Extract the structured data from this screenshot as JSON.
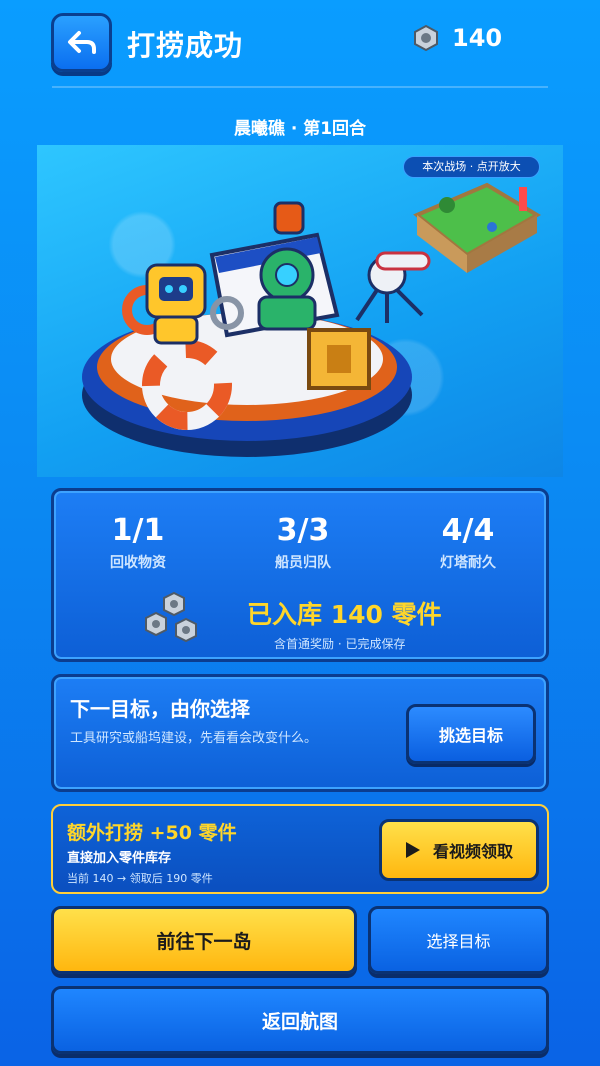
{
  "header": {
    "title": "打捞成功",
    "coins": "140"
  },
  "subtitle": "晨曦礁 · 第1回合",
  "scene": {
    "minimap_label": "本次战场 · 点开放大"
  },
  "stats": {
    "items": [
      {
        "value": "1/1",
        "label": "回收物资"
      },
      {
        "value": "3/3",
        "label": "船员归队"
      },
      {
        "value": "4/4",
        "label": "灯塔耐久"
      }
    ],
    "stored": "已入库 140 零件",
    "note": "含首通奖励 · 已完成保存"
  },
  "next_goal": {
    "title": "下一目标，由你选择",
    "desc": "工具研究或船坞建设，先看看会改变什么。",
    "button": "挑选目标"
  },
  "bonus": {
    "title": "额外打捞 +50 零件",
    "sub": "直接加入零件库存",
    "note": "当前 140 → 领取后 190 零件",
    "button": "看视频领取"
  },
  "actions": {
    "next_island": "前往下一岛",
    "select_target": "选择目标",
    "back_map": "返回航图"
  },
  "colors": {
    "accent": "#ffd62a",
    "panel": "#0d5fd6"
  }
}
